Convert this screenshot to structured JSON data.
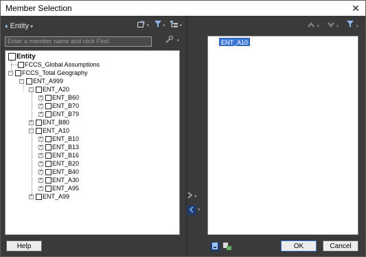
{
  "window": {
    "title": "Member Selection",
    "close_glyph": "✕"
  },
  "left_panel": {
    "dimension": {
      "label": "Entity",
      "icon": "dimension-icon"
    },
    "search": {
      "placeholder": "Enter a member name and click Find.",
      "value": ""
    },
    "tree": [
      {
        "label": "Entity",
        "bold": true,
        "expander": ""
      },
      {
        "label": "FCCS_Global Assumptions",
        "expander": ""
      },
      {
        "label": "FCCS_Total Geography",
        "expander": "⊟"
      },
      {
        "label": "ENT_A999",
        "expander": "⊟"
      },
      {
        "label": "ENT_A20",
        "expander": "⊟"
      },
      {
        "label": "ENT_B60",
        "expander": "⊞"
      },
      {
        "label": "ENT_B70",
        "expander": "⊞"
      },
      {
        "label": "ENT_B79",
        "expander": "⊞"
      },
      {
        "label": "ENT_B80",
        "expander": "⊞"
      },
      {
        "label": "ENT_A10",
        "expander": "⊟"
      },
      {
        "label": "ENT_B10",
        "expander": "⊞"
      },
      {
        "label": "ENT_B13",
        "expander": "⊞"
      },
      {
        "label": "ENT_B16",
        "expander": "⊞"
      },
      {
        "label": "ENT_B20",
        "expander": "⊞"
      },
      {
        "label": "ENT_B40",
        "expander": "⊞"
      },
      {
        "label": "ENT_A30",
        "expander": "⊞"
      },
      {
        "label": "ENT_A95",
        "expander": "⊞"
      },
      {
        "label": "ENT_A99",
        "expander": "⊞"
      }
    ]
  },
  "right_panel": {
    "selected": [
      "ENT_A10"
    ]
  },
  "buttons": {
    "help": "Help",
    "ok": "OK",
    "cancel": "Cancel"
  },
  "colors": {
    "panel_bg": "#3a3a3a",
    "selection": "#3b78d8",
    "active_icon_bg": "#1f3b6a"
  }
}
